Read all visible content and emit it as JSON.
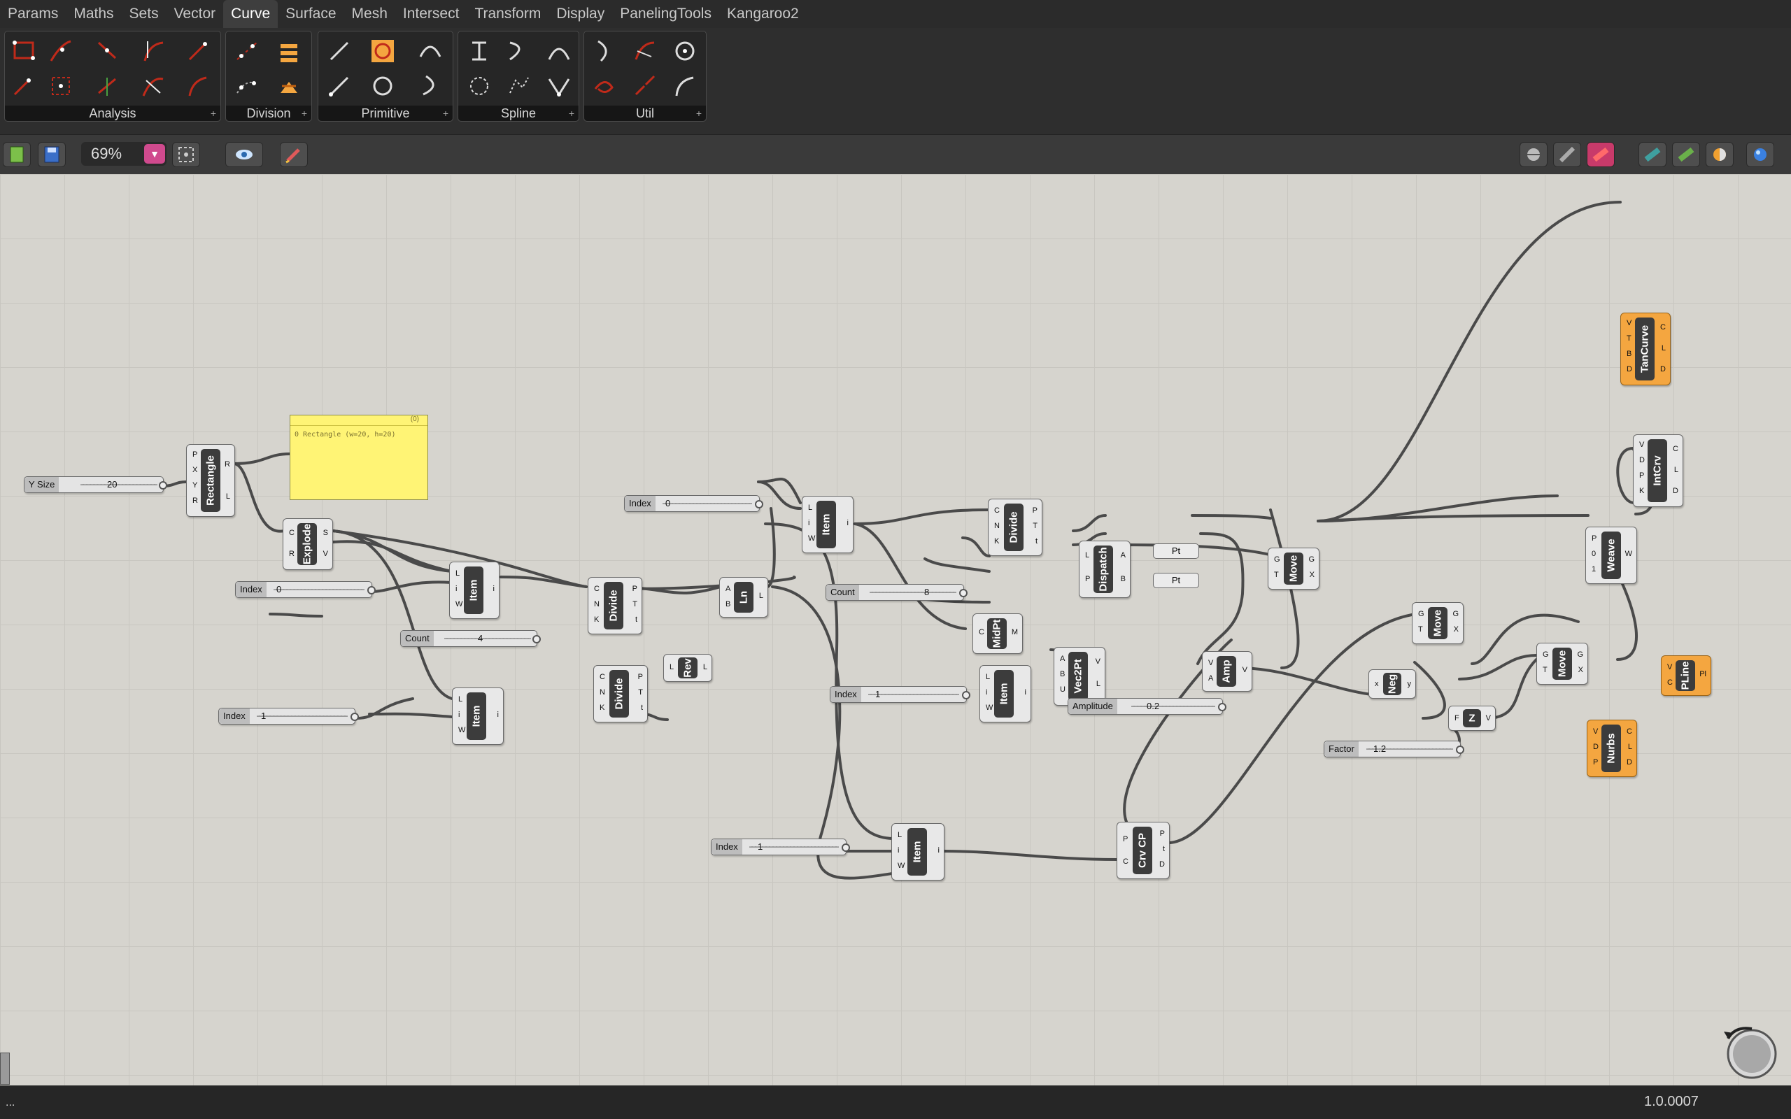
{
  "menubar": {
    "tabs": [
      "Params",
      "Maths",
      "Sets",
      "Vector",
      "Curve",
      "Surface",
      "Mesh",
      "Intersect",
      "Transform",
      "Display",
      "PanelingTools",
      "Kangaroo2"
    ],
    "active": "Curve"
  },
  "ribbon": {
    "panels": [
      "Analysis",
      "Division",
      "Primitive",
      "Spline",
      "Util"
    ]
  },
  "toolbar": {
    "zoom": "69%"
  },
  "canvas": {
    "sliders": {
      "ysize": {
        "label": "Y Size",
        "value": "20"
      },
      "index1": {
        "label": "Index",
        "value": "0"
      },
      "count1": {
        "label": "Count",
        "value": "4"
      },
      "index2": {
        "label": "Index",
        "value": "1"
      },
      "index3": {
        "label": "Index",
        "value": "0"
      },
      "count2": {
        "label": "Count",
        "value": "8"
      },
      "index4": {
        "label": "Index",
        "value": "1"
      },
      "amplitude": {
        "label": "Amplitude",
        "value": "0.2"
      },
      "index5": {
        "label": "Index",
        "value": "1"
      },
      "factor": {
        "label": "Factor",
        "value": "1.2"
      }
    },
    "note": {
      "header": "(0)",
      "text": "0 Rectangle (w=20, h=20)"
    },
    "components": {
      "rectangle": "Rectangle",
      "explode": "Explode",
      "item1": "Item",
      "item2": "Item",
      "divide1": "Divide",
      "divide2": "Divide",
      "rev": "Rev",
      "ln": "Ln",
      "item3": "Item",
      "divide3": "Divide",
      "midpt": "MidPt",
      "item4": "Item",
      "dispatch": "Dispatch",
      "vec2pt": "Vec2Pt",
      "amp": "Amp",
      "move1": "Move",
      "move2": "Move",
      "move3": "Move",
      "neg": "Neg",
      "z": "Z",
      "weave": "Weave",
      "tancurve": "TanCurve",
      "intcrv": "IntCrv",
      "pline": "PLine",
      "nurbs": "Nurbs",
      "item5": "Item",
      "crvcp": "Crv CP"
    },
    "params": {
      "pt": "Pt"
    }
  },
  "status": {
    "left": "...",
    "version": "1.0.0007"
  }
}
